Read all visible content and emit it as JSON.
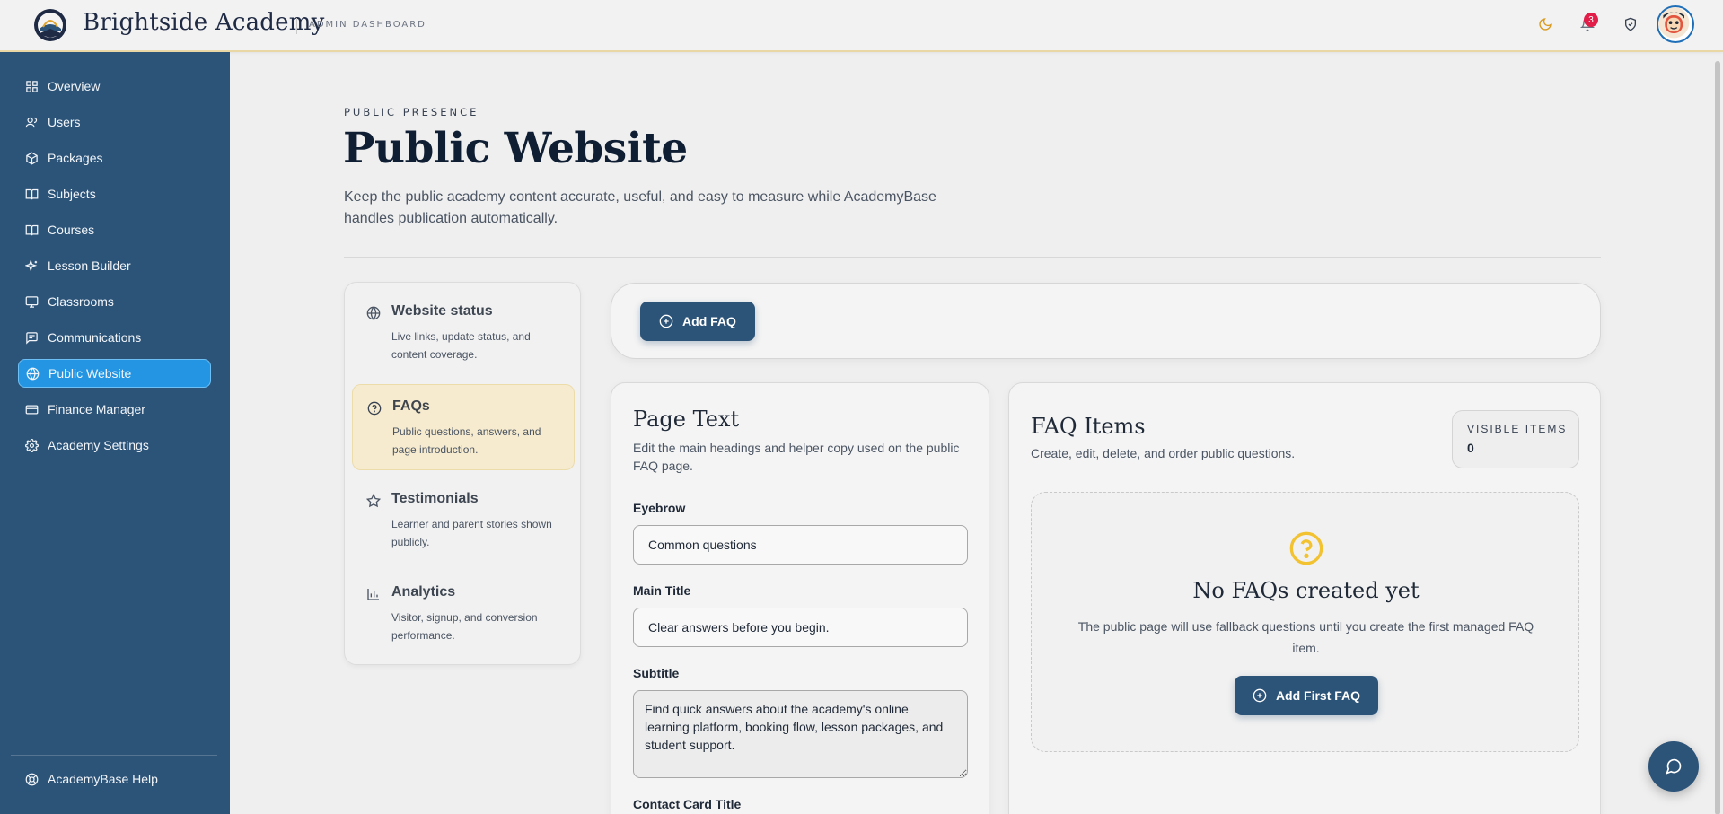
{
  "header": {
    "brand": "Brightside Academy",
    "subtitle": "ADMIN DASHBOARD",
    "notification_count": "3"
  },
  "sidebar": {
    "items": [
      {
        "label": "Overview",
        "icon": "grid-icon"
      },
      {
        "label": "Users",
        "icon": "users-icon"
      },
      {
        "label": "Packages",
        "icon": "package-icon"
      },
      {
        "label": "Subjects",
        "icon": "book-icon"
      },
      {
        "label": "Courses",
        "icon": "book-open-icon"
      },
      {
        "label": "Lesson Builder",
        "icon": "sparkles-icon"
      },
      {
        "label": "Classrooms",
        "icon": "monitor-icon"
      },
      {
        "label": "Communications",
        "icon": "message-icon"
      },
      {
        "label": "Public Website",
        "icon": "globe-icon",
        "active": true
      },
      {
        "label": "Finance Manager",
        "icon": "credit-card-icon"
      },
      {
        "label": "Academy Settings",
        "icon": "gear-icon"
      }
    ],
    "help_label": "AcademyBase Help"
  },
  "page": {
    "eyebrow": "PUBLIC PRESENCE",
    "title": "Public Website",
    "description": "Keep the public academy content accurate, useful, and easy to measure while AcademyBase handles publication automatically."
  },
  "sections": [
    {
      "title": "Website status",
      "desc": "Live links, update status, and content coverage.",
      "icon": "globe-icon"
    },
    {
      "title": "FAQs",
      "desc": "Public questions, answers, and page introduction.",
      "icon": "help-circle-icon",
      "active": true
    },
    {
      "title": "Testimonials",
      "desc": "Learner and parent stories shown publicly.",
      "icon": "star-icon"
    },
    {
      "title": "Analytics",
      "desc": "Visitor, signup, and conversion performance.",
      "icon": "bar-chart-icon"
    }
  ],
  "actions": {
    "add_faq": "Add FAQ"
  },
  "page_text": {
    "title": "Page Text",
    "desc": "Edit the main headings and helper copy used on the public FAQ page.",
    "eyebrow_label": "Eyebrow",
    "eyebrow_value": "Common questions",
    "main_title_label": "Main Title",
    "main_title_value": "Clear answers before you begin.",
    "subtitle_label": "Subtitle",
    "subtitle_value": "Find quick answers about the academy's online learning platform, booking flow, lesson packages, and student support.",
    "contact_label": "Contact Card Title"
  },
  "faq_items": {
    "title": "FAQ Items",
    "desc": "Create, edit, delete, and order public questions.",
    "visible_label": "VISIBLE ITEMS",
    "visible_count": "0",
    "empty_title": "No FAQs created yet",
    "empty_desc": "The public page will use fallback questions until you create the first managed FAQ item.",
    "add_first": "Add First FAQ"
  },
  "colors": {
    "sidebar": "#2c5378",
    "active_nav": "#2495e3",
    "accent_gold": "#f2c230",
    "primary_button": "#2c5378",
    "badge": "#e11d48"
  }
}
